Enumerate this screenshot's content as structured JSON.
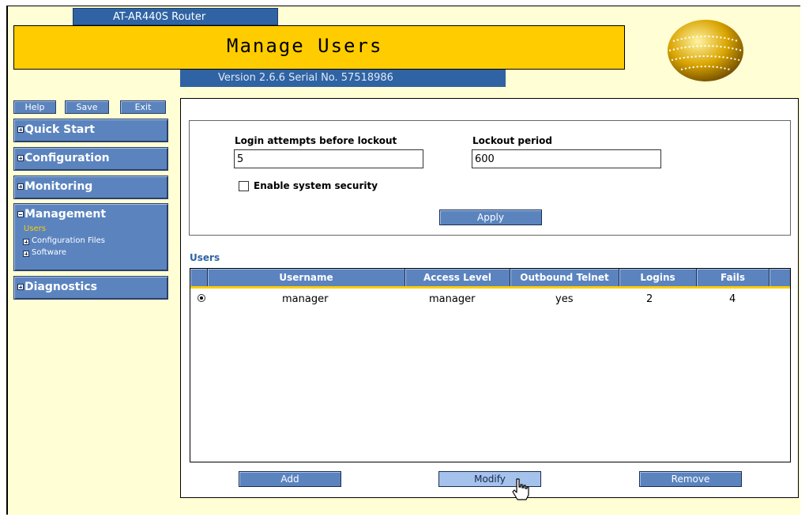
{
  "header": {
    "product": "AT-AR440S Router",
    "title": "Manage Users",
    "version_line": "Version 2.6.6  Serial No. 57518986"
  },
  "toolbar": {
    "help": "Help",
    "save": "Save",
    "exit": "Exit"
  },
  "nav": {
    "quick_start": "Quick Start",
    "configuration": "Configuration",
    "monitoring": "Monitoring",
    "management": "Management",
    "management_items": {
      "users": "Users",
      "configuration_files": "Configuration Files",
      "software": "Software"
    },
    "diagnostics": "Diagnostics"
  },
  "security": {
    "login_attempts_label": "Login attempts before lockout",
    "login_attempts_value": "5",
    "lockout_period_label": "Lockout period",
    "lockout_period_value": "600",
    "enable_label": "Enable system security",
    "enabled": false,
    "apply": "Apply"
  },
  "users": {
    "title": "Users",
    "columns": [
      "Username",
      "Access Level",
      "Outbound Telnet",
      "Logins",
      "Fails"
    ],
    "rows": [
      {
        "selected": true,
        "username": "manager",
        "access_level": "manager",
        "outbound_telnet": "yes",
        "logins": "2",
        "fails": "4"
      }
    ],
    "buttons": {
      "add": "Add",
      "modify": "Modify",
      "remove": "Remove"
    }
  },
  "colors": {
    "title_bar": "#ffcc00",
    "blue": "#2f63a3",
    "button_blue": "#5b84bf",
    "background": "#fffed4"
  }
}
